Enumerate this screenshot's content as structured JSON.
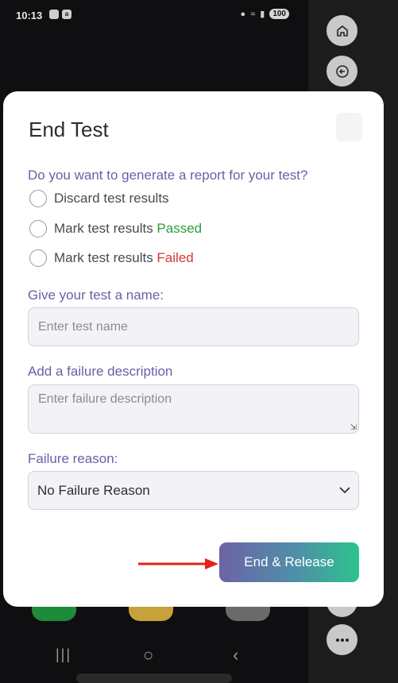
{
  "status_bar": {
    "time": "10:13",
    "badges": [
      "",
      "a"
    ],
    "battery": "100"
  },
  "dialog": {
    "title": "End Test",
    "report_question": "Do you want to generate a report for your test?",
    "options": [
      {
        "prefix": "Discard test results",
        "status": "",
        "status_color": ""
      },
      {
        "prefix": "Mark test results ",
        "status": "Passed",
        "status_color": "#2e9b3e"
      },
      {
        "prefix": "Mark test results ",
        "status": "Failed",
        "status_color": "#d23a3a"
      }
    ],
    "name_label": "Give your test a name:",
    "name_placeholder": "Enter test name",
    "failure_desc_label": "Add a failure description",
    "failure_desc_placeholder": "Enter failure description",
    "failure_reason_label": "Failure reason:",
    "failure_reason_value": "No Failure Reason",
    "end_button": "End & Release"
  },
  "colors": {
    "label_purple": "#6b5fa6",
    "passed_green": "#2e9b3e",
    "failed_red": "#d23a3a",
    "button_gradient": [
      "#6d63a7",
      "#2ec38d"
    ],
    "arrow_red": "#e2231a"
  },
  "icons": {
    "home": "home-icon",
    "back": "back-circle-icon",
    "more": "more-icon"
  }
}
